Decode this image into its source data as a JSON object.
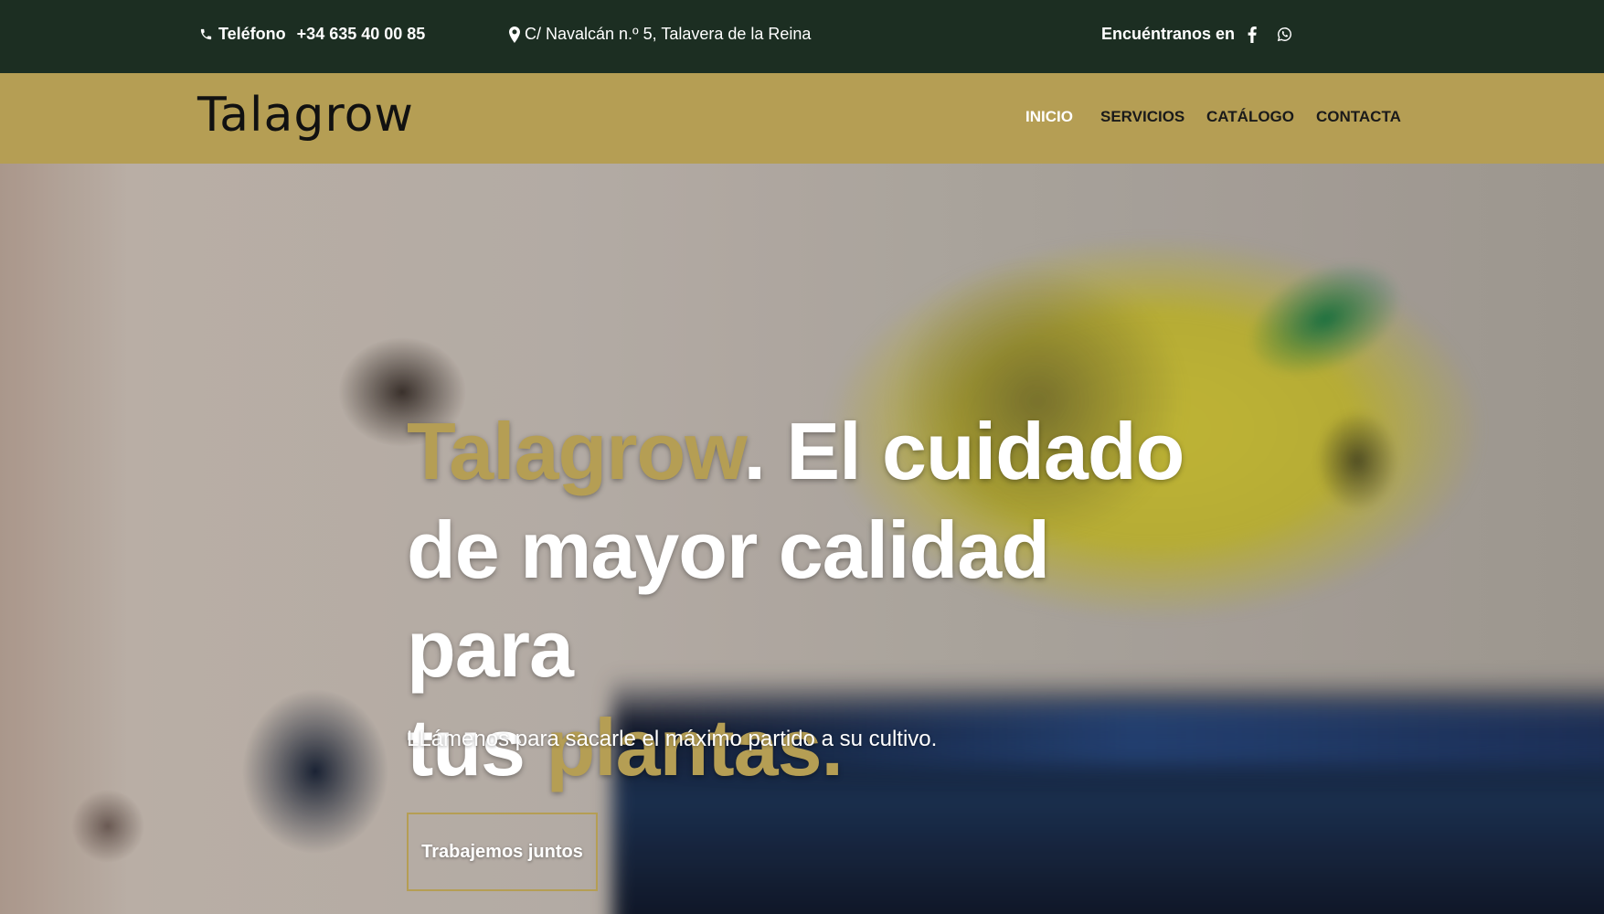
{
  "topbar": {
    "phone_icon": "phone-icon",
    "phone_label": "Teléfono",
    "phone_number": "+34 635 40 00 85",
    "address_icon": "map-pin-icon",
    "address": "C/ Navalcán n.º 5, Talavera de la Reina",
    "social_label": "Encuéntranos en",
    "social_icons": [
      "facebook-icon",
      "whatsapp-icon"
    ]
  },
  "header": {
    "logo": "Talagrow",
    "nav": {
      "inicio": "INICIO",
      "servicios": "SERVICIOS",
      "catalogo": "CATÁLOGO",
      "contacta": "CONTACTA"
    },
    "active_item": "INICIO"
  },
  "hero": {
    "headline_brand": "Talagrow",
    "headline_line1_rest": ". El cuidado",
    "headline_line2": "de mayor calidad para",
    "headline_line3_start": "tus ",
    "headline_highlight": "plantas.",
    "subtitle": "LLámenos para sacarle el máximo partido a su cultivo.",
    "cta_label": "Trabajemos juntos"
  },
  "colors": {
    "topbar_bg": "#1c2e22",
    "navbar_bg": "#b59e54",
    "accent_gold": "#b59e54",
    "nav_active": "#ffffff",
    "nav_text": "#1a1a1a"
  }
}
